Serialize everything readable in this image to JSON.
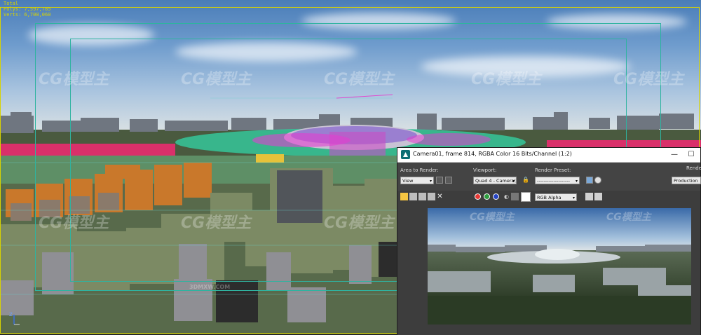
{
  "viewport": {
    "stats": {
      "line1": "Total",
      "line2": "Polys:   7,597,785",
      "line3": "Verts:   6,708,060"
    },
    "watermark": "CG模型主",
    "watermark_url": "3DMXW.COM",
    "axis_label": "Z"
  },
  "render_window": {
    "title": "Camera01, frame 814, RGBA Color 16 Bits/Channel (1:2)",
    "minimize_glyph": "—",
    "maximize_glyph": "☐",
    "area_label": "Area to Render:",
    "area_value": "View",
    "viewport_label": "Viewport:",
    "viewport_value": "Quad 4 - Camera(",
    "preset_label": "Render Preset:",
    "preset_value": "--------------------",
    "render_label": "Rende",
    "render_value": "Production",
    "channel_value": "RGB Alpha",
    "colors": {
      "accent": "#2fb3a0",
      "red_channel": "#e53935",
      "green_channel": "#2e9d3f",
      "blue_channel": "#2745c4"
    }
  }
}
